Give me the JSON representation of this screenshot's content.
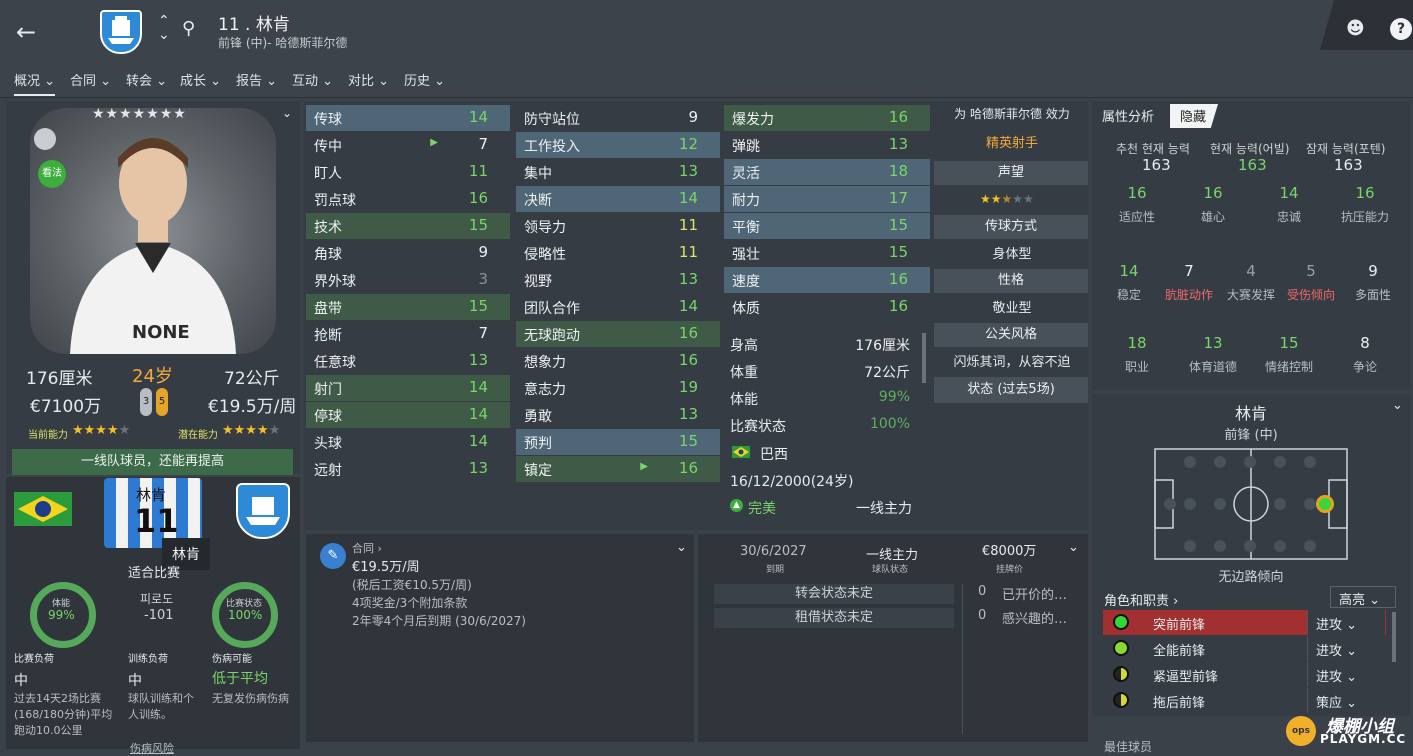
{
  "header": {
    "player_number_name": "11 . 林肯",
    "position_club": "前锋 (中)- 哈德斯菲尔德"
  },
  "nav": [
    "概况",
    "合同",
    "转会",
    "成长",
    "报告",
    "互动",
    "对比",
    "历史"
  ],
  "profile": {
    "stars_shown": "★★★★★★★",
    "face_label": "NONE",
    "badge_text": "看法",
    "height": "176厘米",
    "age": "24岁",
    "weight": "72公斤",
    "value": "€7100万",
    "wage": "€19.5万/周",
    "ca_label": "当前能力",
    "pa_label": "潜在能力",
    "ca_stars": "★★★★",
    "ca_stars_empty": "★",
    "pa_stars": "★★★★",
    "pa_stars_empty": "★",
    "status_bar": "一线队球员，还能再提高",
    "shirt_name": "林肯",
    "shirt_number": "11",
    "tooltip": "林肯",
    "fit_label": "适合比赛",
    "fitness_label": "体能",
    "fitness_val": "99%",
    "match_label": "比赛状态",
    "match_val": "100%",
    "mid_kr": "피로도",
    "mid_val": "-101",
    "pill_a": "3",
    "pill_b": "5"
  },
  "loads": [
    {
      "label": "比赛负荷",
      "value": "中",
      "desc": "过去14天2场比赛(168/180分钟)平均跑动10.0公里"
    },
    {
      "label": "训练负荷",
      "value": "中",
      "desc": "球队训练和个人训练。"
    },
    {
      "label": "伤病可能",
      "value": "低于平均",
      "desc": "无复发伤病伤病"
    }
  ],
  "injury_risk": "伤病风险",
  "attr_col1": [
    {
      "n": "传球",
      "v": "14",
      "c": "g",
      "bg": "bluehl"
    },
    {
      "n": "传中",
      "v": "7",
      "c": "w",
      "arrow": "▲"
    },
    {
      "n": "盯人",
      "v": "11",
      "c": "g"
    },
    {
      "n": "罚点球",
      "v": "16",
      "c": "g"
    },
    {
      "n": "技术",
      "v": "15",
      "c": "g",
      "bg": "greenhl"
    },
    {
      "n": "角球",
      "v": "9",
      "c": "w"
    },
    {
      "n": "界外球",
      "v": "3",
      "c": "gr"
    },
    {
      "n": "盘带",
      "v": "15",
      "c": "g",
      "bg": "greenhl"
    },
    {
      "n": "抢断",
      "v": "7",
      "c": "w"
    },
    {
      "n": "任意球",
      "v": "13",
      "c": "g"
    },
    {
      "n": "射门",
      "v": "14",
      "c": "g",
      "bg": "greenhl"
    },
    {
      "n": "停球",
      "v": "14",
      "c": "g",
      "bg": "greenhl"
    },
    {
      "n": "头球",
      "v": "14",
      "c": "g"
    },
    {
      "n": "远射",
      "v": "13",
      "c": "g"
    }
  ],
  "attr_col2": [
    {
      "n": "防守站位",
      "v": "9",
      "c": "w"
    },
    {
      "n": "工作投入",
      "v": "12",
      "c": "g",
      "bg": "bluehl"
    },
    {
      "n": "集中",
      "v": "13",
      "c": "g"
    },
    {
      "n": "决断",
      "v": "14",
      "c": "g",
      "bg": "bluehl"
    },
    {
      "n": "领导力",
      "v": "11",
      "c": "y"
    },
    {
      "n": "侵略性",
      "v": "11",
      "c": "y"
    },
    {
      "n": "视野",
      "v": "13",
      "c": "g"
    },
    {
      "n": "团队合作",
      "v": "14",
      "c": "g"
    },
    {
      "n": "无球跑动",
      "v": "16",
      "c": "g",
      "bg": "greenhl"
    },
    {
      "n": "想象力",
      "v": "16",
      "c": "g"
    },
    {
      "n": "意志力",
      "v": "19",
      "c": "g"
    },
    {
      "n": "勇敢",
      "v": "13",
      "c": "g"
    },
    {
      "n": "预判",
      "v": "15",
      "c": "g",
      "bg": "bluehl"
    },
    {
      "n": "镇定",
      "v": "16",
      "c": "g",
      "bg": "greenhl",
      "arrow": "▲"
    }
  ],
  "attr_col3": [
    {
      "n": "爆发力",
      "v": "16",
      "c": "g",
      "bg": "greenhl"
    },
    {
      "n": "弹跳",
      "v": "13",
      "c": "g"
    },
    {
      "n": "灵活",
      "v": "18",
      "c": "g",
      "bg": "bluehl"
    },
    {
      "n": "耐力",
      "v": "17",
      "c": "g",
      "bg": "bluehl"
    },
    {
      "n": "平衡",
      "v": "15",
      "c": "g",
      "bg": "bluehl"
    },
    {
      "n": "强壮",
      "v": "15",
      "c": "g"
    },
    {
      "n": "速度",
      "v": "16",
      "c": "g",
      "bg": "bluehl"
    },
    {
      "n": "体质",
      "v": "16",
      "c": "g"
    }
  ],
  "info": [
    {
      "k": "身高",
      "v": "176厘米"
    },
    {
      "k": "体重",
      "v": "72公斤"
    },
    {
      "k": "体能",
      "v": "99%"
    },
    {
      "k": "比赛状态",
      "v": "100%"
    }
  ],
  "nation": "巴西",
  "dob": "16/12/2000(24岁)",
  "perfect": "完美",
  "squad_role": "一线主力",
  "mid_right": {
    "for_club": "为 哈德斯菲尔德 效力",
    "star_player": "精英射手",
    "rep_btn": "声望",
    "pass_btn": "传球方式",
    "pass_val": "身体型",
    "pers_btn": "性格",
    "pers_val": "敬业型",
    "media_btn": "公关风格",
    "media_val": "闪烁其词，从容不迫",
    "form_btn": "状态 (过去5场)"
  },
  "analysis": {
    "tab1": "属性分析",
    "tab2": "隐藏",
    "h1": "추천 현재 능력",
    "h2": "현재 능력(어빌)",
    "h3": "잠재 능력(포텐)",
    "v1": "163",
    "v2": "163",
    "v3": "163",
    "row1": [
      {
        "v": "16",
        "l": "适应性"
      },
      {
        "v": "16",
        "l": "雄心"
      },
      {
        "v": "14",
        "l": "忠诚"
      },
      {
        "v": "16",
        "l": "抗压能力"
      }
    ],
    "row2": [
      {
        "v": "14",
        "l": "稳定",
        "c": "g",
        "lc": "gr2"
      },
      {
        "v": "7",
        "l": "肮脏动作",
        "c": "w",
        "lc": "r"
      },
      {
        "v": "4",
        "l": "大赛发挥",
        "c": "gr",
        "lc": "gr2"
      },
      {
        "v": "5",
        "l": "受伤倾向",
        "c": "gr",
        "lc": "r"
      },
      {
        "v": "9",
        "l": "多面性",
        "c": "w",
        "lc": "gr2"
      }
    ],
    "row3": [
      {
        "v": "18",
        "l": "职业"
      },
      {
        "v": "13",
        "l": "体育道德"
      },
      {
        "v": "15",
        "l": "情绪控制"
      },
      {
        "v": "8",
        "l": "争论",
        "c": "w"
      }
    ]
  },
  "position_panel": {
    "name": "林肯",
    "pos": "前锋 (中)",
    "inside_label": "无边路倾向",
    "roles_title": "角色和职责",
    "highlight_btn": "高亮",
    "roles": [
      {
        "n": "突前前锋",
        "d": "进攻",
        "hl": true
      },
      {
        "n": "全能前锋",
        "d": "进攻"
      },
      {
        "n": "紧逼型前锋",
        "d": "进攻"
      },
      {
        "n": "拖后前锋",
        "d": "策应"
      }
    ],
    "best_label": "最佳球员"
  },
  "contract": {
    "label": "合同",
    "wage": "€19.5万/周",
    "after_tax": "(税后工资€10.5万/周)",
    "bonus": "4项奖金/3个附加条款",
    "expiry": "2年零4个月后到期 (30/6/2027)"
  },
  "transfer": {
    "expiry_date": "30/6/2027",
    "expiry_label": "到期",
    "squad_status": "一线主力",
    "status_label": "球队状态",
    "asking": "€8000万",
    "asking_label": "挂牌价",
    "transfer_status": "转会状态未定",
    "loan_status": "租借状态未定",
    "offers_n": "0",
    "offers_l": "已开价的…",
    "interest_n": "0",
    "interest_l": "感兴趣的…"
  },
  "watermark": {
    "t1": "爆棚小组",
    "t2": "PLAYGM.CC"
  }
}
